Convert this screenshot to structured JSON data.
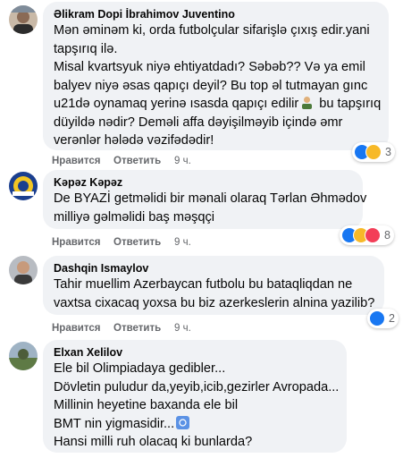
{
  "ui": {
    "like_label": "Нравится",
    "reply_label": "Ответить"
  },
  "colors": {
    "bubble_bg": "#f0f2f5",
    "meta_text": "#65676b",
    "like_blue": "#1877f2",
    "haha_yellow": "#f7b928",
    "love_red": "#f33e58"
  },
  "comments": [
    {
      "author": "Əlikram Dopi İbrahimov Juventino",
      "lines": [
        "Mən əminəm ki, orda futbolçular sifarişlə çıxış edir.yani",
        "tapşırıq ilə.",
        "Misal kvartsyuk niyə ehtiyatdadı? Səbəb?? Və ya emil",
        "balyev niyə əsas qapıçı deyil? Bu top əl tutmayan gınc",
        "u21də oynamaq yerinə ısasda qapıçı edilir",
        " bu tapşırıq",
        "düyildə nədir? Deməli affa dəyişilməyib içində əmr",
        "verənlər hələdə vəzifədədir!"
      ],
      "time": "9 ч.",
      "reaction_icons": [
        "like-icon",
        "haha-icon"
      ],
      "reaction_count": "3"
    },
    {
      "author": "Kəpəz Kəpəz",
      "lines": [
        "De BYAZİ getməlidi bir mənali olaraq Tərlan Əhmədov",
        "milliyə gəlməlidi baş məşqçi"
      ],
      "time": "9 ч.",
      "reaction_icons": [
        "like-icon",
        "haha-icon",
        "angry-icon"
      ],
      "reaction_count": "8"
    },
    {
      "author": "Dashqin Ismaylov",
      "lines": [
        "Tahir muellim Azerbaycan futbolu bu bataqliqdan ne",
        "vaxtsa cixacaq yoxsa bu biz azerkeslerin alnina yazilib?"
      ],
      "time": "9 ч.",
      "reaction_icons": [
        "like-icon"
      ],
      "reaction_count": "2"
    },
    {
      "author": "Elxan Xelilov",
      "lines": [
        "Ele bil Olimpiadaya gedibler...",
        "Dövletin puludur da,yeyib,icib,gezirler Avropada...",
        "Millinin heyetine baxanda ele bil",
        "BMT nin yigmasidir...",
        "Hansi milli ruh olacaq ki bunlarda?"
      ]
    }
  ]
}
